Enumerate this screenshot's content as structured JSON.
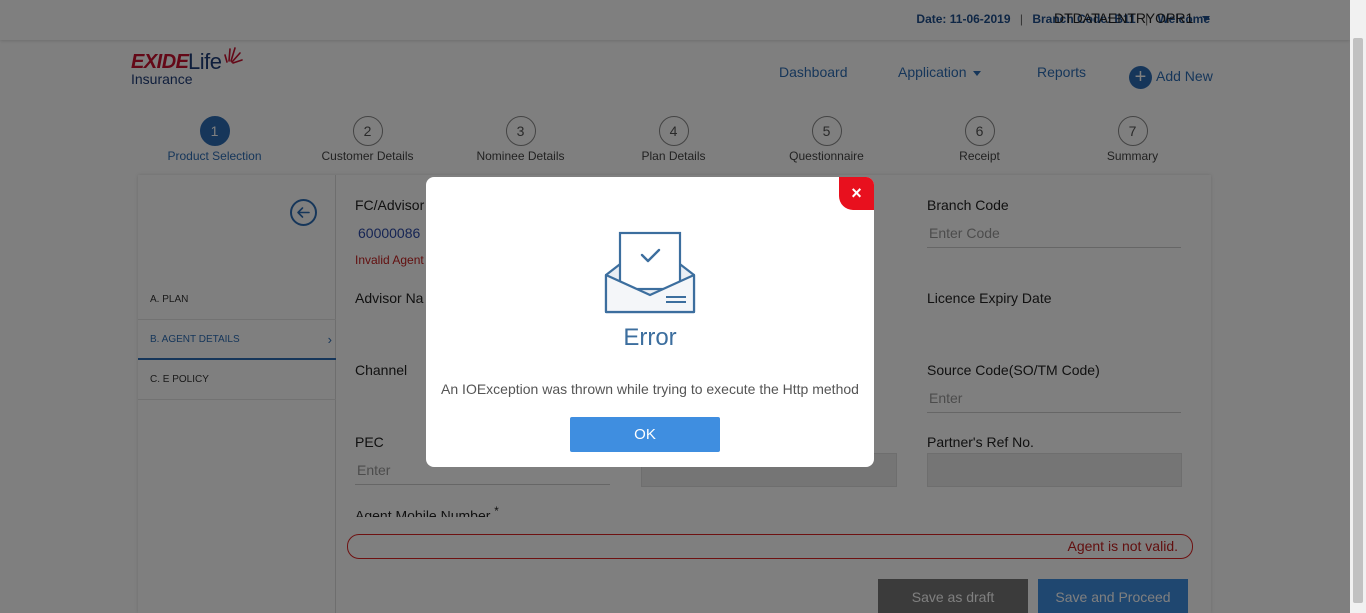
{
  "topbar": {
    "date_label": "Date:",
    "date_value": "11-06-2019",
    "branch_label": "Branch Code:",
    "branch_value": "B11",
    "welcome_label": "Welcome",
    "user": "DTDATAENTRYOPR1"
  },
  "logo": {
    "brand": "EXIDE",
    "life": "Life",
    "insurance": "Insurance"
  },
  "nav": {
    "dashboard": "Dashboard",
    "application": "Application",
    "reports": "Reports",
    "add_new": "Add New"
  },
  "steps": [
    {
      "num": "1",
      "label": "Product Selection",
      "active": true
    },
    {
      "num": "2",
      "label": "Customer Details"
    },
    {
      "num": "3",
      "label": "Nominee Details"
    },
    {
      "num": "4",
      "label": "Plan Details"
    },
    {
      "num": "5",
      "label": "Questionnaire"
    },
    {
      "num": "6",
      "label": "Receipt"
    },
    {
      "num": "7",
      "label": "Summary"
    }
  ],
  "sidebar": {
    "items": [
      {
        "label": "A. PLAN"
      },
      {
        "label": "B. AGENT DETAILS",
        "active": true
      },
      {
        "label": "C. E POLICY"
      }
    ]
  },
  "form": {
    "fc_advisor_label": "FC/Advisor",
    "fc_advisor_value": "60000086",
    "invalid_agent": "Invalid Agent",
    "branch_code_label": "Branch Code",
    "branch_code_placeholder": "Enter Code",
    "advisor_name_label": "Advisor Na",
    "licence_expiry_label": "Licence Expiry Date",
    "channel_label": "Channel",
    "source_code_label": "Source Code(SO/TM Code)",
    "source_code_placeholder": "Enter",
    "pec_label": "PEC",
    "pec_placeholder": "Enter",
    "partner_ref_label": "Partner's Ref No.",
    "agent_mobile_label": "Agent Mobile Number",
    "agent_mobile_required": "*",
    "error_banner": "Agent is not valid.",
    "save_draft": "Save as draft",
    "save_proceed": "Save and Proceed"
  },
  "modal": {
    "close_glyph": "×",
    "title": "Error",
    "message": "An IOException was thrown while trying to execute the Http method",
    "ok_label": "OK"
  },
  "colors": {
    "accent": "#2d6db5",
    "error": "#e8101e",
    "button": "#3f8ee0"
  }
}
